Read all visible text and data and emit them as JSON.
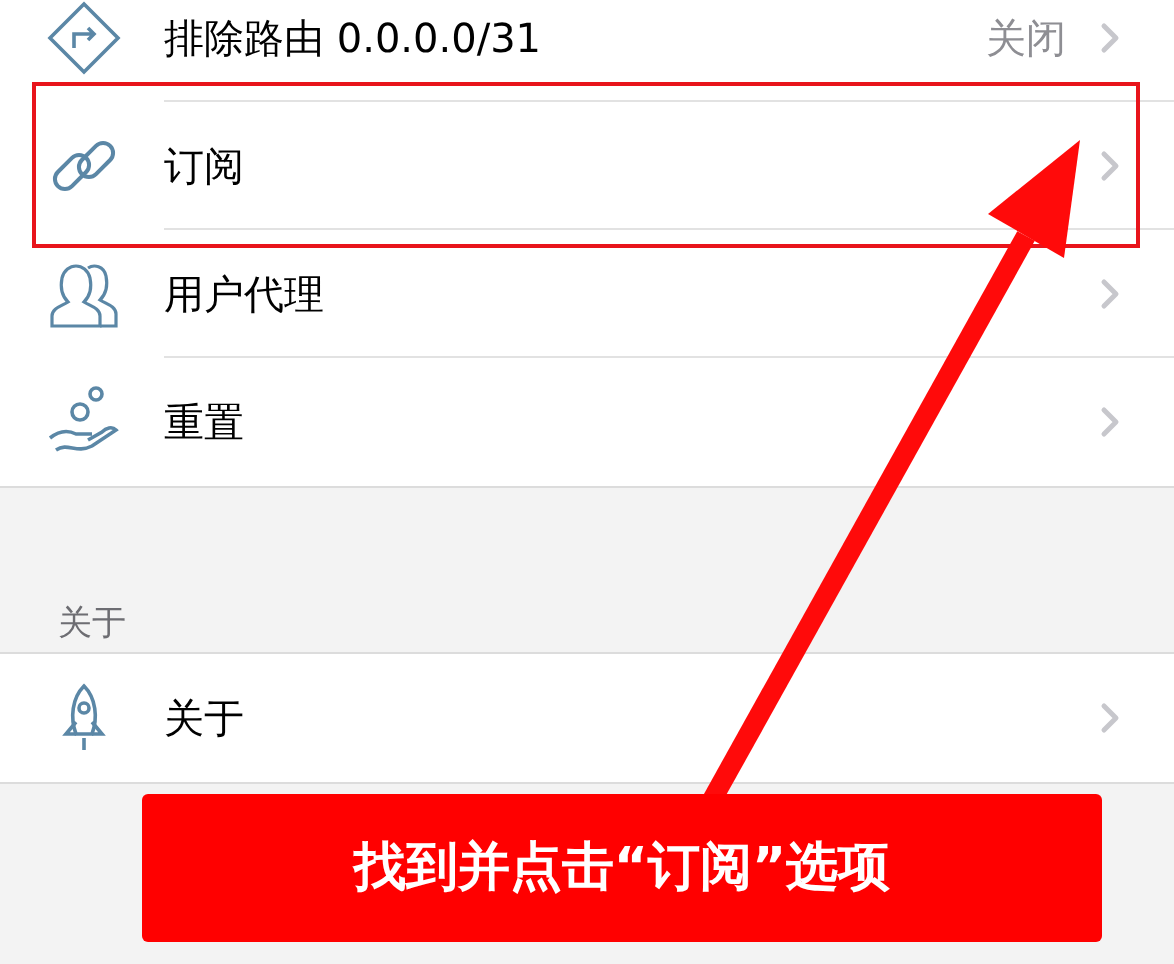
{
  "sections": [
    {
      "items": [
        {
          "label": "排除路由 0.0.0.0/31",
          "value": "关闭",
          "highlighted": false
        },
        {
          "label": "订阅",
          "highlighted": true
        },
        {
          "label": "用户代理",
          "highlighted": false
        },
        {
          "label": "重置",
          "highlighted": false
        }
      ]
    },
    {
      "header": "关于",
      "items": [
        {
          "label": "关于",
          "highlighted": false
        }
      ]
    }
  ],
  "annotation": {
    "caption": "找到并点击“订阅”选项"
  }
}
